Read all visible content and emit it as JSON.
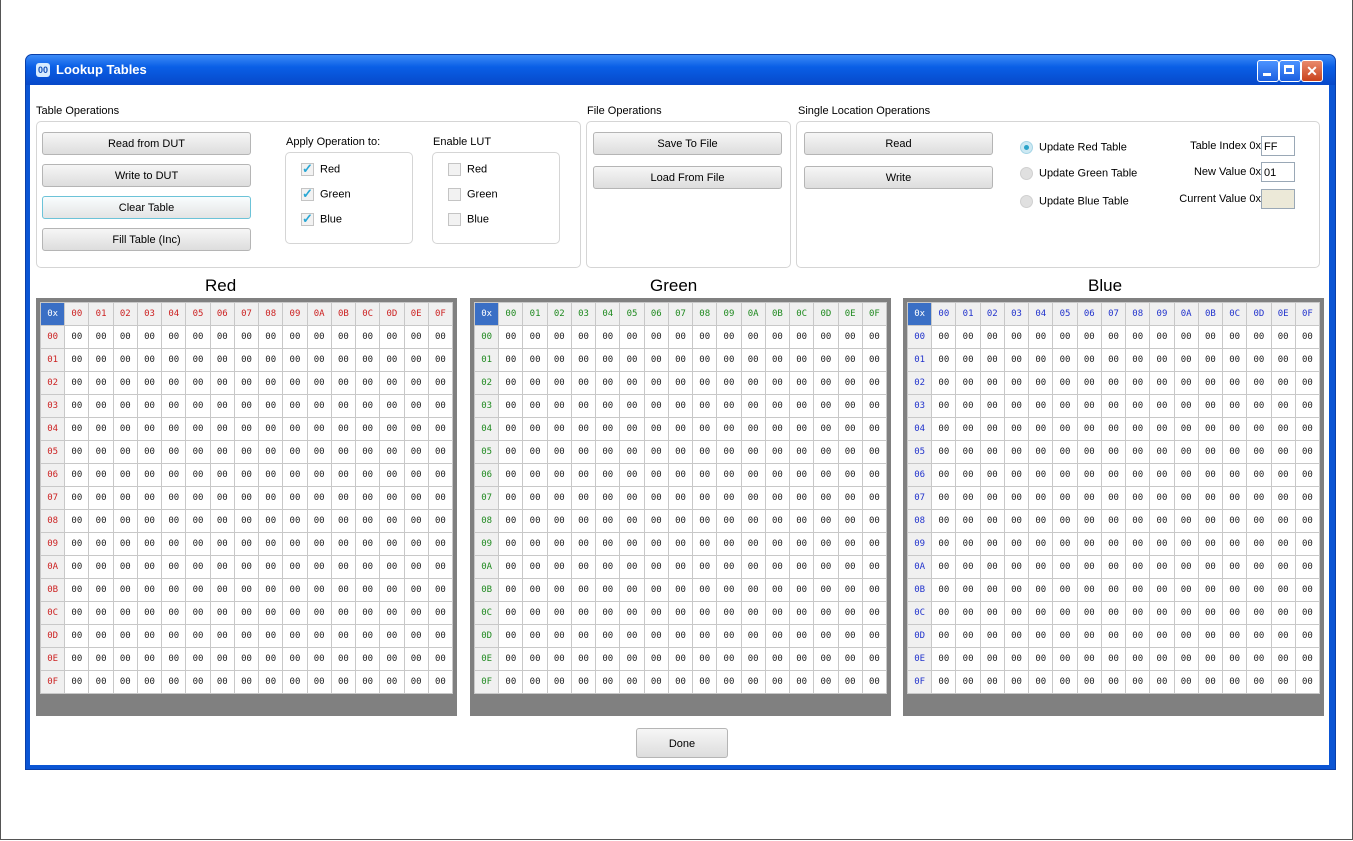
{
  "window": {
    "title": "Lookup Tables",
    "icon": "app-icon",
    "icon_text": "00"
  },
  "table_ops": {
    "title": "Table Operations",
    "buttons": [
      "Read from DUT",
      "Write to DUT",
      "Clear Table",
      "Fill Table (Inc)"
    ]
  },
  "apply_op": {
    "title": "Apply Operation to:",
    "items": [
      {
        "label": "Red",
        "checked": true
      },
      {
        "label": "Green",
        "checked": true
      },
      {
        "label": "Blue",
        "checked": true
      }
    ]
  },
  "enable_lut": {
    "title": "Enable LUT",
    "items": [
      {
        "label": "Red",
        "checked": false
      },
      {
        "label": "Green",
        "checked": false
      },
      {
        "label": "Blue",
        "checked": false
      }
    ]
  },
  "file_ops": {
    "title": "File Operations",
    "save": "Save To File",
    "load": "Load From File"
  },
  "single_ops": {
    "title": "Single Location Operations",
    "read": "Read",
    "write": "Write",
    "radios": [
      {
        "label": "Update Red Table",
        "selected": true
      },
      {
        "label": "Update Green Table",
        "selected": false
      },
      {
        "label": "Update Blue Table",
        "selected": false
      }
    ],
    "table_index_label": "Table Index 0x",
    "table_index": "FF",
    "new_value_label": "New Value 0x",
    "new_value": "01",
    "current_value_label": "Current Value 0x",
    "current_value": ""
  },
  "tables": [
    {
      "name": "Red",
      "color": "#cc2222"
    },
    {
      "name": "Green",
      "color": "#208a20"
    },
    {
      "name": "Blue",
      "color": "#2233cc"
    }
  ],
  "grid": {
    "corner": "0x",
    "col_headers": [
      "00",
      "01",
      "02",
      "03",
      "04",
      "05",
      "06",
      "07",
      "08",
      "09",
      "0A",
      "0B",
      "0C",
      "0D",
      "0E",
      "0F"
    ],
    "row_headers": [
      "00",
      "01",
      "02",
      "03",
      "04",
      "05",
      "06",
      "07",
      "08",
      "09",
      "0A",
      "0B",
      "0C",
      "0D",
      "0E",
      "0F"
    ],
    "cell_value": "00"
  },
  "done": "Done"
}
